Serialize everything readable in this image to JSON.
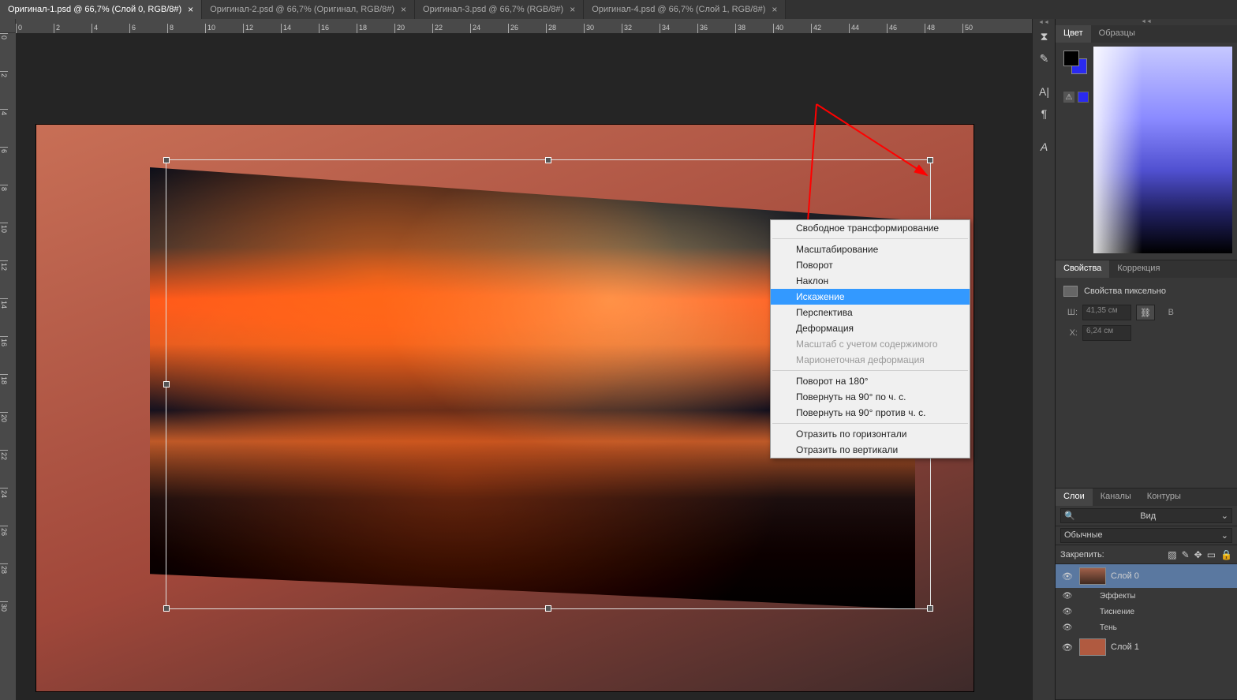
{
  "tabs": [
    {
      "label": "Оригинал-1.psd @ 66,7% (Слой 0, RGB/8#)",
      "active": true
    },
    {
      "label": "Оригинал-2.psd @ 66,7% (Оригинал, RGB/8#)",
      "active": false
    },
    {
      "label": "Оригинал-3.psd @ 66,7% (RGB/8#)",
      "active": false
    },
    {
      "label": "Оригинал-4.psd @ 66,7% (Слой 1, RGB/8#)",
      "active": false
    }
  ],
  "ruler_h": [
    "0",
    "2",
    "4",
    "6",
    "8",
    "10",
    "12",
    "14",
    "16",
    "18",
    "20",
    "22",
    "24",
    "26",
    "28",
    "30",
    "32",
    "34",
    "36",
    "38",
    "40",
    "42",
    "44",
    "46",
    "48",
    "50"
  ],
  "ruler_v": [
    "0",
    "2",
    "4",
    "6",
    "8",
    "10",
    "12",
    "14",
    "16",
    "18",
    "20",
    "22",
    "24",
    "26",
    "28",
    "30"
  ],
  "ctx_menu": {
    "groups": [
      [
        {
          "label": "Свободное трансформирование"
        }
      ],
      [
        {
          "label": "Масштабирование"
        },
        {
          "label": "Поворот"
        },
        {
          "label": "Наклон"
        },
        {
          "label": "Искажение",
          "highlight": true
        },
        {
          "label": "Перспектива"
        },
        {
          "label": "Деформация"
        },
        {
          "label": "Масштаб с учетом содержимого",
          "disabled": true
        },
        {
          "label": "Марионеточная деформация",
          "disabled": true
        }
      ],
      [
        {
          "label": "Поворот на 180°"
        },
        {
          "label": "Повернуть на 90° по ч. с."
        },
        {
          "label": "Повернуть на 90° против ч. с."
        }
      ],
      [
        {
          "label": "Отразить по горизонтали"
        },
        {
          "label": "Отразить по вертикали"
        }
      ]
    ]
  },
  "color_panel": {
    "tabs": {
      "color": "Цвет",
      "swatches": "Образцы"
    }
  },
  "props_panel": {
    "tabs": {
      "props": "Свойства",
      "adjust": "Коррекция"
    },
    "title": "Свойства пиксельно",
    "w_label": "Ш:",
    "w_value": "41,35 см",
    "x_label": "X:",
    "x_value": "6,24 см",
    "h_label": "В"
  },
  "layers_panel": {
    "tabs": {
      "layers": "Слои",
      "channels": "Каналы",
      "paths": "Контуры"
    },
    "kind_label": "Вид",
    "search_icon": "🔍",
    "blend_mode": "Обычные",
    "lock_label": "Закрепить:",
    "layers": [
      {
        "name": "Слой 0",
        "selected": true,
        "thumb": "landscape",
        "fx": true
      },
      {
        "name": "Слой 1",
        "selected": false,
        "thumb": "solid",
        "fx": false
      }
    ],
    "fx_label": "Эффекты",
    "fx_items": [
      "Тиснение",
      "Тень"
    ]
  }
}
